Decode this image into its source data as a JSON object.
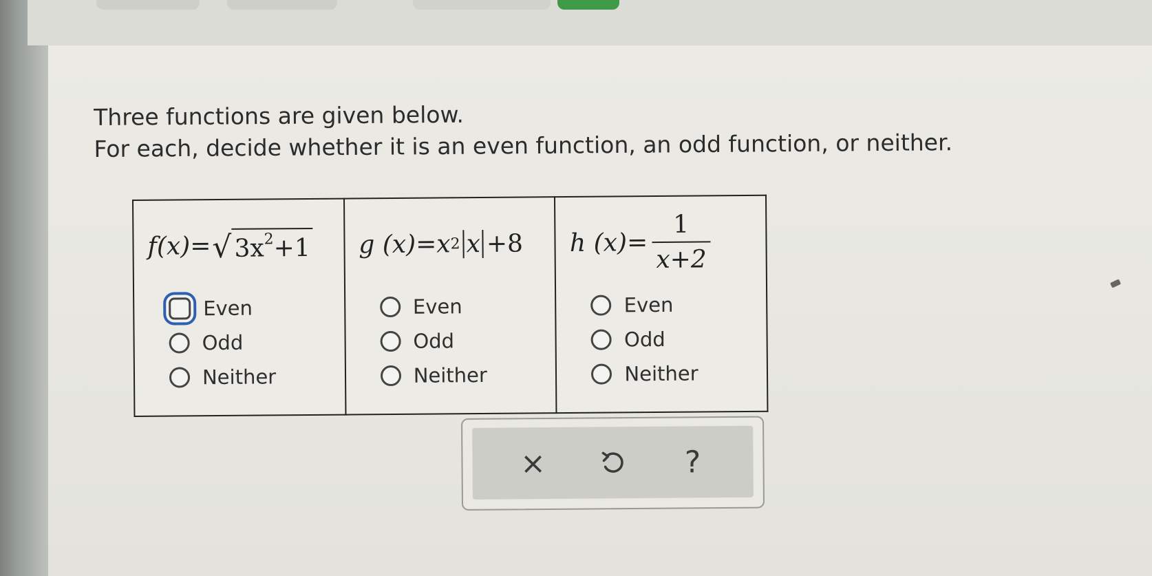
{
  "prompt": {
    "line1": "Three functions are given below.",
    "line2": "For each, decide whether it is an even function, an odd function, or neither."
  },
  "functions": [
    {
      "name": "f",
      "lhs": "f(x)=",
      "radicand_coef": "3x",
      "exponent": "2",
      "radicand_tail": "+1",
      "options": [
        "Even",
        "Odd",
        "Neither"
      ]
    },
    {
      "name": "g",
      "lhs": "g (x)=x",
      "exponent": "2",
      "abs_var": "x",
      "tail": "+8",
      "options": [
        "Even",
        "Odd",
        "Neither"
      ]
    },
    {
      "name": "h",
      "lhs": "h (x)=",
      "numerator": "1",
      "denominator": "x+2",
      "options": [
        "Even",
        "Odd",
        "Neither"
      ]
    }
  ],
  "focused_option": "f-even",
  "actions": {
    "clear_symbol": "×",
    "help_symbol": "?"
  },
  "icons": {
    "clear": "close-icon",
    "undo": "undo-icon",
    "help": "help-icon"
  },
  "colors": {
    "focus_ring": "#2e5fb0",
    "background": "#e9e8e2"
  }
}
